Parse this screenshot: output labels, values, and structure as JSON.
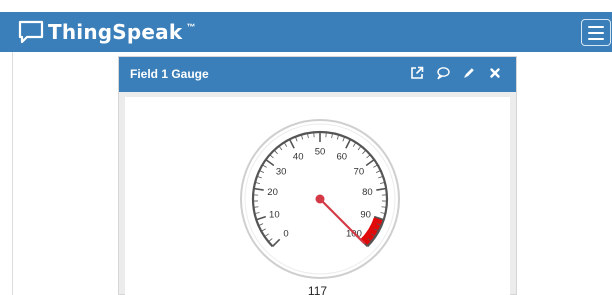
{
  "app": {
    "brand": "ThingSpeak",
    "trademark": "™"
  },
  "nav": {
    "menu_icon": "hamburger-menu-icon"
  },
  "widget": {
    "title": "Field 1 Gauge",
    "actions": [
      {
        "icon": "external-link-icon"
      },
      {
        "icon": "comment-icon"
      },
      {
        "icon": "pencil-icon"
      },
      {
        "icon": "close-icon"
      }
    ]
  },
  "gauge": {
    "min": 0,
    "max": 100,
    "value": 117,
    "value_label": "117",
    "tick_labels": [
      "0",
      "10",
      "20",
      "30",
      "40",
      "50",
      "60",
      "70",
      "80",
      "90",
      "100"
    ],
    "red_zone": [
      90,
      100
    ]
  },
  "colors": {
    "header_blue": "#3a7fba",
    "needle": "#d43a46",
    "red_zone": "#e10a0a",
    "scale": "#555555"
  }
}
